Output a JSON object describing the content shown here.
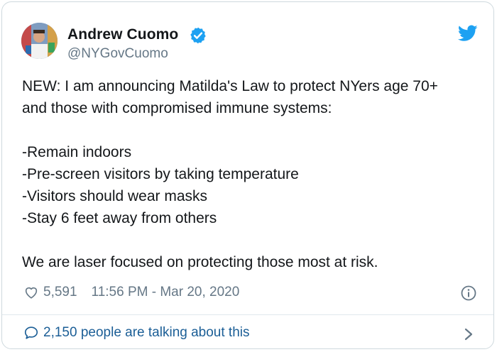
{
  "tweet": {
    "author_name": "Andrew Cuomo",
    "handle": "@NYGovCuomo",
    "text_lines": [
      "NEW: I am announcing Matilda's Law to protect NYers age 70+",
      "and those with compromised immune systems:",
      "",
      "-Remain indoors",
      "-Pre-screen visitors by taking temperature",
      "-Visitors should wear masks",
      "-Stay 6 feet away from others",
      "",
      "We are laser focused on protecting those most at risk."
    ],
    "likes": "5,591",
    "timestamp": "11:56 PM - Mar 20, 2020",
    "conversation": "2,150 people are talking about this"
  },
  "icons": {
    "verified": "verified-badge-icon",
    "brand": "twitter-bird-icon",
    "like": "heart-icon",
    "info": "info-icon",
    "reply": "speech-bubble-icon",
    "more": "chevron-right-icon"
  },
  "colors": {
    "twitter_blue": "#1da1f2",
    "link_blue": "#1b5e96",
    "secondary_text": "#657786",
    "border": "#cfd9de"
  }
}
